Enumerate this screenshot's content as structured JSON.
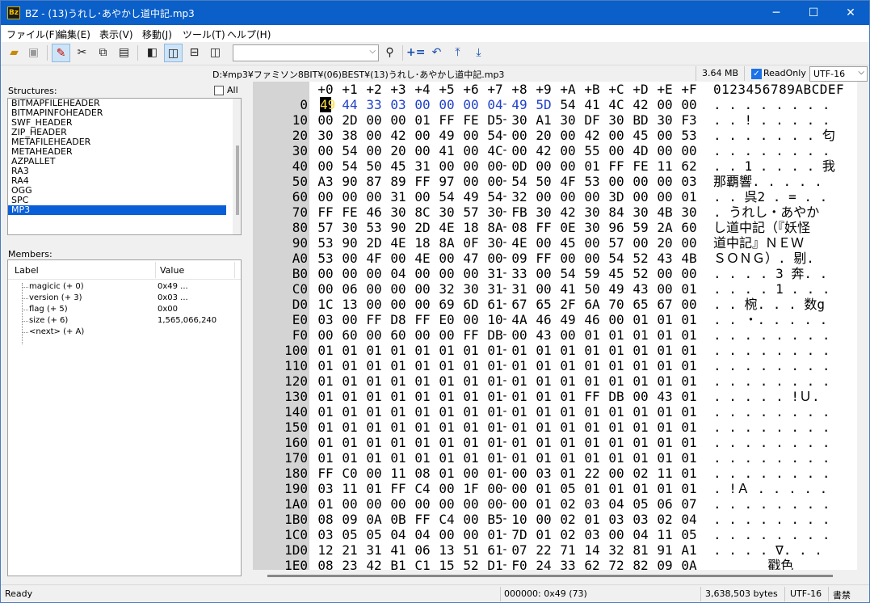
{
  "window": {
    "title": "BZ - (13)うれし･あやかし道中記.mp3",
    "app_icon": "Bz"
  },
  "menu": [
    "ファイル(F)",
    "編集(E)",
    "表示(V)",
    "移動(J)",
    "ツール(T)",
    "ヘルプ(H)"
  ],
  "toolbar": {
    "icons": [
      "open-folder-icon",
      "save-icon",
      "edit-mode-icon",
      "cut-icon",
      "copy-icon",
      "paste-icon",
      "view-single-icon",
      "view-dual-icon",
      "view-split-h-icon",
      "view-split-v-icon",
      "find-icon",
      "add-equal-icon",
      "back-icon",
      "jump-top-icon",
      "jump-bottom-icon"
    ],
    "search_value": ""
  },
  "pathbar": {
    "path": "D:¥mp3¥ファミソン8BIT¥(06)BEST¥(13)うれし･あやかし道中記.mp3",
    "size": "3.64 MB",
    "readonly_label": "ReadOnly",
    "readonly_checked": true,
    "encoding": "UTF-16"
  },
  "structures": {
    "label": "Structures:",
    "all_label": "All",
    "items": [
      "BITMAPFILEHEADER",
      "BITMAPINFOHEADER",
      "SWF_HEADER",
      "ZIP_HEADER",
      "METAFILEHEADER",
      "METAHEADER",
      "AZPALLET",
      "RA3",
      "RA4",
      "OGG",
      "SPC",
      "MP3"
    ],
    "selected": "MP3"
  },
  "members": {
    "label": "Members:",
    "col_label": "Label",
    "col_value": "Value",
    "rows": [
      {
        "label": "magicic (+ 0)",
        "value": "0x49 ..."
      },
      {
        "label": "version (+ 3)",
        "value": "0x03 ..."
      },
      {
        "label": "flag (+ 5)",
        "value": "0x00"
      },
      {
        "label": "size (+ 6)",
        "value": "1,565,066,240"
      },
      {
        "label": "<next> (+ A)",
        "value": ""
      }
    ]
  },
  "hex": {
    "header_cols": [
      "+0",
      "+1",
      "+2",
      "+3",
      "+4",
      "+5",
      "+6",
      "+7",
      "+8",
      "+9",
      "+A",
      "+B",
      "+C",
      "+D",
      "+E",
      "+F"
    ],
    "header_text": "0123456789ABCDEF",
    "rows": [
      {
        "addr": "0",
        "bytes": [
          "49",
          "44",
          "33",
          "03",
          "00",
          "00",
          "00",
          "04",
          "49",
          "5D",
          "54",
          "41",
          "4C",
          "42",
          "00",
          "00"
        ],
        "text": ". . . . . . . ."
      },
      {
        "addr": "10",
        "bytes": [
          "00",
          "2D",
          "00",
          "00",
          "01",
          "FF",
          "FE",
          "D5",
          "30",
          "A1",
          "30",
          "DF",
          "30",
          "BD",
          "30",
          "F3"
        ],
        "text": ". . ! . . . . ."
      },
      {
        "addr": "20",
        "bytes": [
          "30",
          "38",
          "00",
          "42",
          "00",
          "49",
          "00",
          "54",
          "00",
          "20",
          "00",
          "42",
          "00",
          "45",
          "00",
          "53"
        ],
        "text": ". . . . . . . 匂"
      },
      {
        "addr": "30",
        "bytes": [
          "00",
          "54",
          "00",
          "20",
          "00",
          "41",
          "00",
          "4C",
          "00",
          "42",
          "00",
          "55",
          "00",
          "4D",
          "00",
          "00"
        ],
        "text": ". . . . . . . ."
      },
      {
        "addr": "40",
        "bytes": [
          "00",
          "54",
          "50",
          "45",
          "31",
          "00",
          "00",
          "00",
          "0D",
          "00",
          "00",
          "01",
          "FF",
          "FE",
          "11",
          "62"
        ],
        "text": ". . 1 . . . . 我"
      },
      {
        "addr": "50",
        "bytes": [
          "A3",
          "90",
          "87",
          "89",
          "FF",
          "97",
          "00",
          "00",
          "54",
          "50",
          "4F",
          "53",
          "00",
          "00",
          "00",
          "03"
        ],
        "text": "那覇響. . . . ."
      },
      {
        "addr": "60",
        "bytes": [
          "00",
          "00",
          "00",
          "31",
          "00",
          "54",
          "49",
          "54",
          "32",
          "00",
          "00",
          "00",
          "3D",
          "00",
          "00",
          "01"
        ],
        "text": ". . 呉2 . = . ."
      },
      {
        "addr": "70",
        "bytes": [
          "FF",
          "FE",
          "46",
          "30",
          "8C",
          "30",
          "57",
          "30",
          "FB",
          "30",
          "42",
          "30",
          "84",
          "30",
          "4B",
          "30"
        ],
        "text": ". うれし・あやか"
      },
      {
        "addr": "80",
        "bytes": [
          "57",
          "30",
          "53",
          "90",
          "2D",
          "4E",
          "18",
          "8A",
          "08",
          "FF",
          "0E",
          "30",
          "96",
          "59",
          "2A",
          "60"
        ],
        "text": "し道中記（『妖怪"
      },
      {
        "addr": "90",
        "bytes": [
          "53",
          "90",
          "2D",
          "4E",
          "18",
          "8A",
          "0F",
          "30",
          "4E",
          "00",
          "45",
          "00",
          "57",
          "00",
          "20",
          "00"
        ],
        "text": "道中記』ＮＥＷ "
      },
      {
        "addr": "A0",
        "bytes": [
          "53",
          "00",
          "4F",
          "00",
          "4E",
          "00",
          "47",
          "00",
          "09",
          "FF",
          "00",
          "00",
          "54",
          "52",
          "43",
          "4B"
        ],
        "text": "ＳＯＮＧ）. 剔."
      },
      {
        "addr": "B0",
        "bytes": [
          "00",
          "00",
          "00",
          "04",
          "00",
          "00",
          "00",
          "31",
          "33",
          "00",
          "54",
          "59",
          "45",
          "52",
          "00",
          "00"
        ],
        "text": ". . . . 3 奔. ."
      },
      {
        "addr": "C0",
        "bytes": [
          "00",
          "06",
          "00",
          "00",
          "00",
          "32",
          "30",
          "31",
          "31",
          "00",
          "41",
          "50",
          "49",
          "43",
          "00",
          "01"
        ],
        "text": ". . . . 1 . . ."
      },
      {
        "addr": "D0",
        "bytes": [
          "1C",
          "13",
          "00",
          "00",
          "00",
          "69",
          "6D",
          "61",
          "67",
          "65",
          "2F",
          "6A",
          "70",
          "65",
          "67",
          "00"
        ],
        "text": ". . 椀. . . 数g"
      },
      {
        "addr": "E0",
        "bytes": [
          "03",
          "00",
          "FF",
          "D8",
          "FF",
          "E0",
          "00",
          "10",
          "4A",
          "46",
          "49",
          "46",
          "00",
          "01",
          "01",
          "01"
        ],
        "text": ". . ・. . . . ."
      },
      {
        "addr": "F0",
        "bytes": [
          "00",
          "60",
          "00",
          "60",
          "00",
          "00",
          "FF",
          "DB",
          "00",
          "43",
          "00",
          "01",
          "01",
          "01",
          "01",
          "01"
        ],
        "text": ". . . . . . . ."
      },
      {
        "addr": "100",
        "bytes": [
          "01",
          "01",
          "01",
          "01",
          "01",
          "01",
          "01",
          "01",
          "01",
          "01",
          "01",
          "01",
          "01",
          "01",
          "01",
          "01"
        ],
        "text": ". . . . . . . ."
      },
      {
        "addr": "110",
        "bytes": [
          "01",
          "01",
          "01",
          "01",
          "01",
          "01",
          "01",
          "01",
          "01",
          "01",
          "01",
          "01",
          "01",
          "01",
          "01",
          "01"
        ],
        "text": ". . . . . . . ."
      },
      {
        "addr": "120",
        "bytes": [
          "01",
          "01",
          "01",
          "01",
          "01",
          "01",
          "01",
          "01",
          "01",
          "01",
          "01",
          "01",
          "01",
          "01",
          "01",
          "01"
        ],
        "text": ". . . . . . . ."
      },
      {
        "addr": "130",
        "bytes": [
          "01",
          "01",
          "01",
          "01",
          "01",
          "01",
          "01",
          "01",
          "01",
          "01",
          "01",
          "FF",
          "DB",
          "00",
          "43",
          "01"
        ],
        "text": ". . . . . !Ｕ. "
      },
      {
        "addr": "140",
        "bytes": [
          "01",
          "01",
          "01",
          "01",
          "01",
          "01",
          "01",
          "01",
          "01",
          "01",
          "01",
          "01",
          "01",
          "01",
          "01",
          "01"
        ],
        "text": ". . . . . . . ."
      },
      {
        "addr": "150",
        "bytes": [
          "01",
          "01",
          "01",
          "01",
          "01",
          "01",
          "01",
          "01",
          "01",
          "01",
          "01",
          "01",
          "01",
          "01",
          "01",
          "01"
        ],
        "text": ". . . . . . . ."
      },
      {
        "addr": "160",
        "bytes": [
          "01",
          "01",
          "01",
          "01",
          "01",
          "01",
          "01",
          "01",
          "01",
          "01",
          "01",
          "01",
          "01",
          "01",
          "01",
          "01"
        ],
        "text": ". . . . . . . ."
      },
      {
        "addr": "170",
        "bytes": [
          "01",
          "01",
          "01",
          "01",
          "01",
          "01",
          "01",
          "01",
          "01",
          "01",
          "01",
          "01",
          "01",
          "01",
          "01",
          "01"
        ],
        "text": ". . . . . . . ."
      },
      {
        "addr": "180",
        "bytes": [
          "FF",
          "C0",
          "00",
          "11",
          "08",
          "01",
          "00",
          "01",
          "00",
          "03",
          "01",
          "22",
          "00",
          "02",
          "11",
          "01"
        ],
        "text": ". . . . . . . ."
      },
      {
        "addr": "190",
        "bytes": [
          "03",
          "11",
          "01",
          "FF",
          "C4",
          "00",
          "1F",
          "00",
          "00",
          "01",
          "05",
          "01",
          "01",
          "01",
          "01",
          "01"
        ],
        "text": ". !Ａ . . . . ."
      },
      {
        "addr": "1A0",
        "bytes": [
          "01",
          "00",
          "00",
          "00",
          "00",
          "00",
          "00",
          "00",
          "00",
          "01",
          "02",
          "03",
          "04",
          "05",
          "06",
          "07"
        ],
        "text": ". . . . . . . ."
      },
      {
        "addr": "1B0",
        "bytes": [
          "08",
          "09",
          "0A",
          "0B",
          "FF",
          "C4",
          "00",
          "B5",
          "10",
          "00",
          "02",
          "01",
          "03",
          "03",
          "02",
          "04"
        ],
        "text": ". . . . . . . ."
      },
      {
        "addr": "1C0",
        "bytes": [
          "03",
          "05",
          "05",
          "04",
          "04",
          "00",
          "00",
          "01",
          "7D",
          "01",
          "02",
          "03",
          "00",
          "04",
          "11",
          "05"
        ],
        "text": ". . . . . . . ."
      },
      {
        "addr": "1D0",
        "bytes": [
          "12",
          "21",
          "31",
          "41",
          "06",
          "13",
          "51",
          "61",
          "07",
          "22",
          "71",
          "14",
          "32",
          "81",
          "91",
          "A1"
        ],
        "text": ". . . . ∇. . ."
      },
      {
        "addr": "1E0",
        "bytes": [
          "08",
          "23",
          "42",
          "B1",
          "C1",
          "15",
          "52",
          "D1",
          "F0",
          "24",
          "33",
          "62",
          "72",
          "82",
          "09",
          "0A"
        ],
        "text": "       戳色"
      }
    ]
  },
  "status": {
    "ready": "Ready",
    "position": "000000: 0x49 (73)",
    "bytes": "3,638,503 bytes",
    "encoding": "UTF-16",
    "mode": "書禁"
  }
}
